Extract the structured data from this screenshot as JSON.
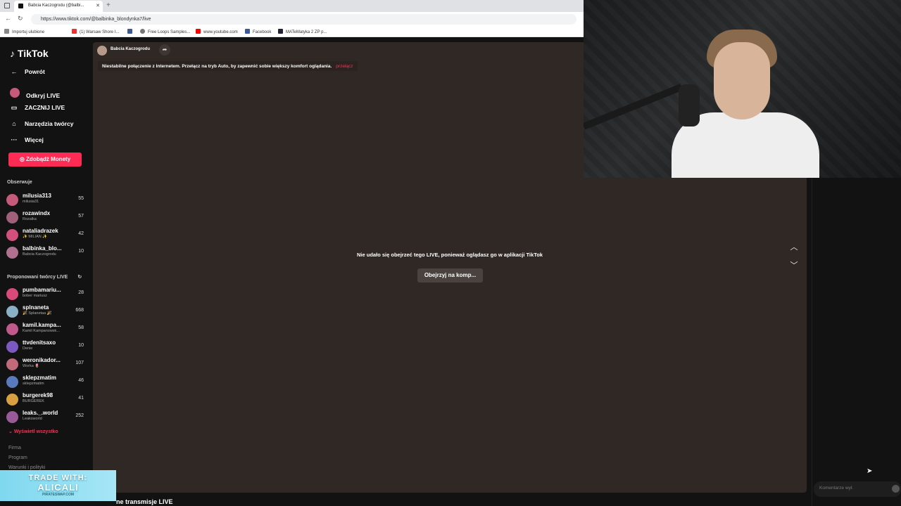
{
  "browser": {
    "tab_title": "Babcia Kaczogrodu (@balbi...",
    "url": "https://www.tiktok.com/@balbinka_blondynka7/live",
    "bookmarks": [
      "Importuj ulubione",
      "(1) Warsaw Shore I...",
      "Free Loops Samples...",
      "www.youtube.com",
      "Facebook",
      "MATeMatyka 2 ZP p..."
    ]
  },
  "sidebar": {
    "logo": "TikTok",
    "nav": [
      {
        "label": "Powrót",
        "icon": "arrow-left-icon"
      },
      {
        "label": "Odkryj LIVE",
        "icon": "live-avatar-icon"
      },
      {
        "label": "ZACZNIJ LIVE",
        "icon": "video-camera-icon"
      },
      {
        "label": "Narzędzia twórcy",
        "icon": "home-icon"
      },
      {
        "label": "Więcej",
        "icon": "more-dots-icon"
      }
    ],
    "coins_button": "Zdobądź Monety",
    "following_header": "Obserwuje",
    "following": [
      {
        "name": "milusia313",
        "sub": "milusia31",
        "count": "55",
        "color": "#c65a7a"
      },
      {
        "name": "rozawindx",
        "sub": "Rozalka",
        "count": "57",
        "color": "#a0607a"
      },
      {
        "name": "nataliadrazek",
        "sub": "✨ MILIAN ✨",
        "count": "42",
        "color": "#d2507a"
      },
      {
        "name": "balbinka_blo...",
        "sub": "Babcia Kaczogrodu",
        "count": "10",
        "color": "#b07090"
      }
    ],
    "suggested_header": "Proponowani twórcy LIVE",
    "suggested": [
      {
        "name": "pumbamariu...",
        "sub": "bober mariusz",
        "count": "28",
        "color": "#d84a7a"
      },
      {
        "name": "splnaneta",
        "sub": "🎉 Splanetaa 🎉",
        "count": "668",
        "color": "#8ab0c8"
      },
      {
        "name": "kamil.kampa...",
        "sub": "Kamil Kampanowsk...",
        "count": "58",
        "color": "#c05a8a"
      },
      {
        "name": "ttvdenitsaxo",
        "sub": "Denie",
        "count": "10",
        "color": "#7a5ac0"
      },
      {
        "name": "weronikador...",
        "sub": "Worka 🌷",
        "count": "107",
        "color": "#c06a7a"
      },
      {
        "name": "sklepzmatim",
        "sub": "sklepzmatim",
        "count": "46",
        "color": "#5a7ac0"
      },
      {
        "name": "burgerek98",
        "sub": "BURGEREK",
        "count": "41",
        "color": "#d8a040"
      },
      {
        "name": "leaks._.world",
        "sub": "Leaksworld",
        "count": "252",
        "color": "#9a5a9a"
      }
    ],
    "show_all": "Wyświetl wszystko",
    "footer": [
      "Firma",
      "Program",
      "Warunki i polityki"
    ]
  },
  "promo": {
    "line1": "TRADE WITH:",
    "line2": "ALICALI",
    "line3": "PIRATESWAP.COM"
  },
  "live": {
    "host_name": "Babcia Kaczogrodu",
    "warning": "Niestabilne połączenie z Internetem. Przełącz na tryb Auto, by zapewnić sobie większy komfort oglądania.",
    "warning_action": "przełącz",
    "message": "Nie udało się obejrzeć tego LIVE, ponieważ oglądasz go w aplikacji TikTok",
    "watch_button": "Obejrzyj na komp..."
  },
  "comment_placeholder": "Komentarze wył.",
  "bottom_text": "ne transmisje LIVE"
}
